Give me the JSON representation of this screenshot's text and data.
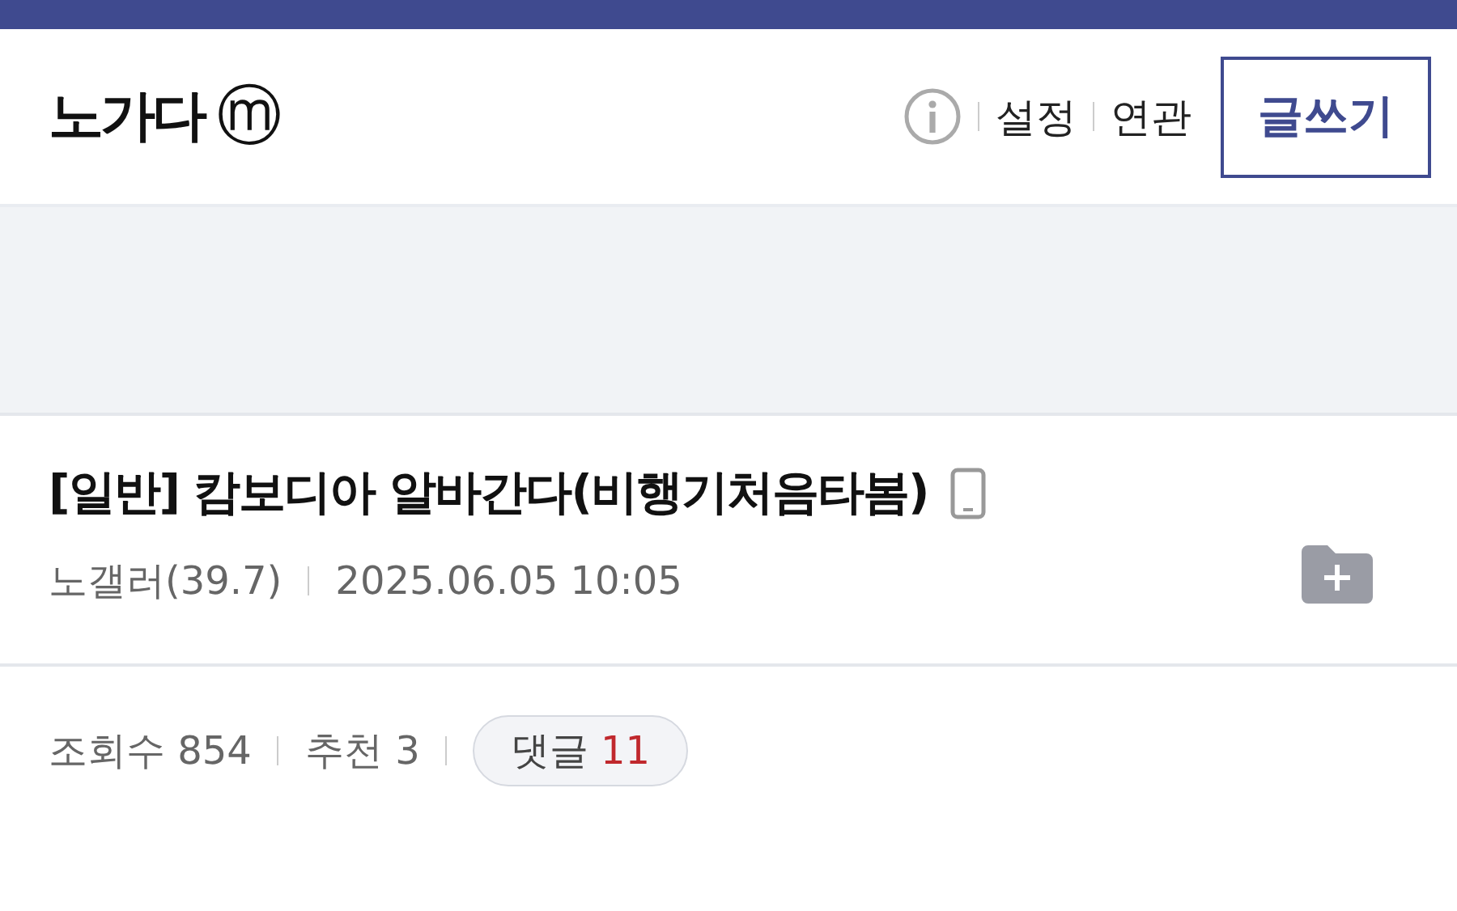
{
  "header": {
    "title": "노가다",
    "badge": "ⓜ",
    "links": [
      "설정",
      "연관"
    ],
    "write_button": "글쓰기"
  },
  "post": {
    "title": "[일반] 캄보디아 알바간다(비행기처음타봄)",
    "author": "노갤러(39.7)",
    "date": "2025.06.05 10:05",
    "views": "조회수 854",
    "recommend": "추천 3",
    "comments_label": "댓글",
    "comments_count": "11"
  }
}
